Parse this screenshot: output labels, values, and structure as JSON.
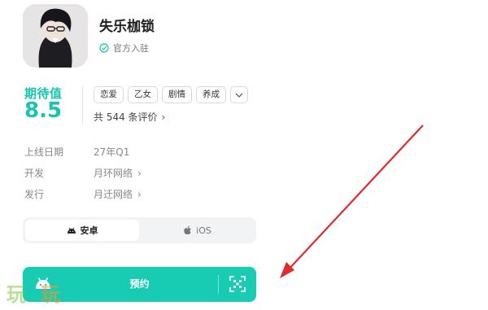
{
  "app": {
    "title": "失乐枷锁",
    "verified_label": "官方入驻"
  },
  "rating": {
    "label": "期待值",
    "value": "8.5"
  },
  "tags": [
    "恋爱",
    "乙女",
    "剧情",
    "养成"
  ],
  "reviews": {
    "text": "共 544 条评价"
  },
  "info": [
    {
      "label": "上线日期",
      "value": "27年Q1"
    },
    {
      "label": "开发",
      "value": "月环网络"
    },
    {
      "label": "发行",
      "value": "月迁网络"
    }
  ],
  "platforms": {
    "android_label": "安卓",
    "ios_label": "iOS",
    "selected": "android"
  },
  "reserve": {
    "label": "预约"
  },
  "watermark": [
    "玩",
    "玩"
  ],
  "colors": {
    "accent": "#17ccb3",
    "annotation": "#e02b2b"
  },
  "icons": {
    "verified": "check-circle-icon",
    "android": "android-icon",
    "apple": "apple-icon",
    "scan": "qr-scan-icon",
    "chevron": "chevron-right-icon",
    "more": "chevron-down-icon"
  }
}
